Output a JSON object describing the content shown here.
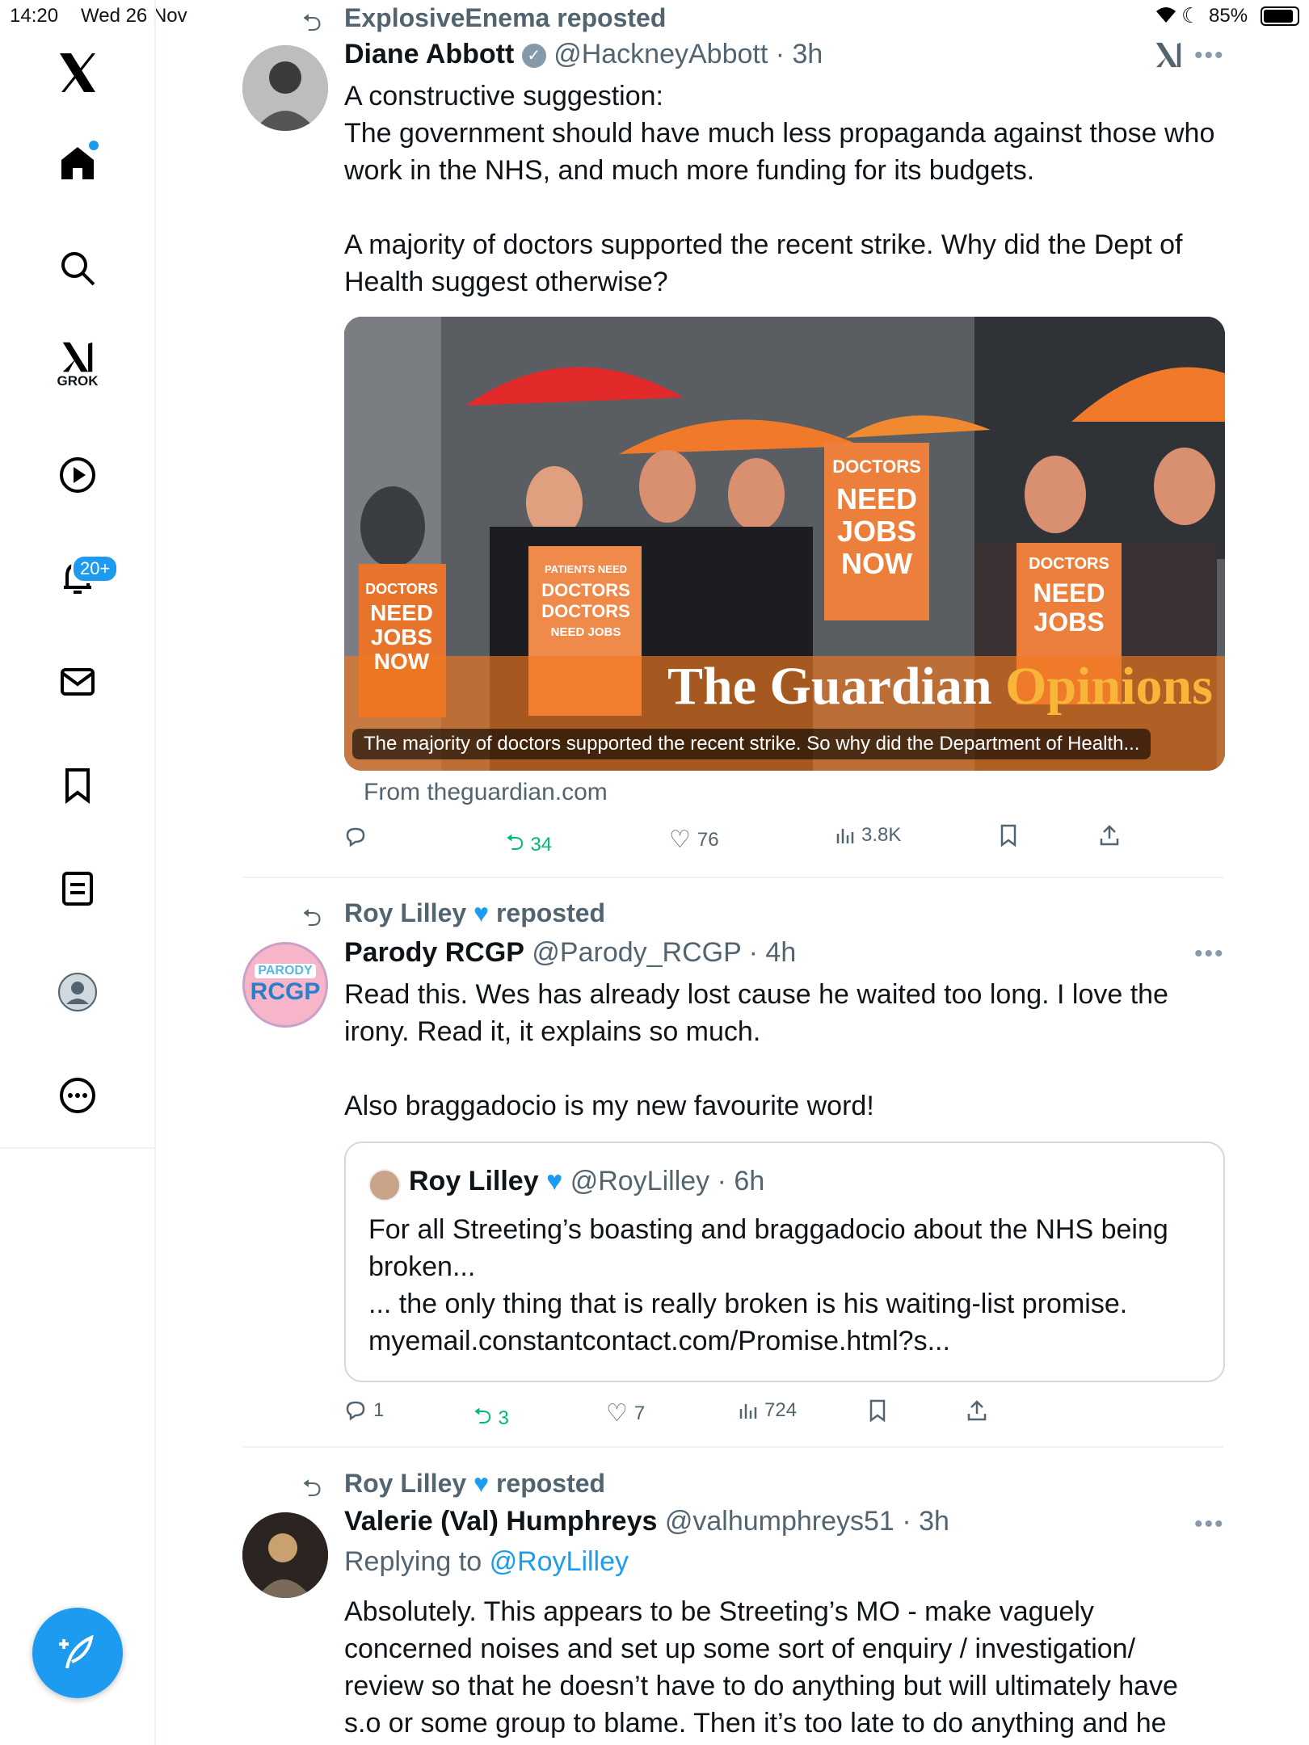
{
  "status": {
    "time": "14:20",
    "date": "Wed 26 Nov",
    "battery": "85%"
  },
  "sidebar": {
    "grok_label": "GROK",
    "notif_badge": "20+"
  },
  "posts": [
    {
      "repost_by": "ExplosiveEnema reposted",
      "name": "Diane Abbott",
      "handle": "@HackneyAbbott",
      "time": "3h",
      "text": "A constructive suggestion:\nThe government should have much less propaganda against those who work in the NHS, and much more funding for its budgets.\n\nA majority of doctors supported the recent strike. Why did the Dept of Health suggest otherwise?",
      "card": {
        "caption": "The majority of doctors supported the recent strike. So why did the Department of Health...",
        "source": "From theguardian.com",
        "brand": "The Guardian",
        "brand2": "Opinions"
      },
      "stats": {
        "replies": "",
        "reposts": "34",
        "likes": "76",
        "views": "3.8K"
      }
    },
    {
      "repost_by_name": "Roy Lilley",
      "repost_label": "reposted",
      "name": "Parody RCGP",
      "handle": "@Parody_RCGP",
      "time": "4h",
      "avatar": {
        "top": "PARODY",
        "main": "RCGP"
      },
      "text": "Read this. Wes has already lost cause he waited too long. I love the irony. Read it, it explains so much.\n\nAlso braggadocio is my new favourite word!",
      "quote": {
        "name": "Roy Lilley",
        "handle": "@RoyLilley",
        "time": "6h",
        "text": "For all Streeting’s boasting and braggadocio about the NHS being broken...\n... the only thing that is really broken is his waiting-list promise.\nmyemail.constantcontact.com/Promise.html?s..."
      },
      "stats": {
        "replies": "1",
        "reposts": "3",
        "likes": "7",
        "views": "724"
      }
    },
    {
      "repost_by_name": "Roy Lilley",
      "repost_label": "reposted",
      "name": "Valerie (Val) Humphreys",
      "handle": "@valhumphreys51",
      "time": "3h",
      "reply_label": "Replying to",
      "reply_to": "@RoyLilley",
      "text": "Absolutely. This  appears to be Streeting’s MO - make vaguely concerned noises and set up some sort of enquiry / investigation/ review so that he doesn’t have to do anything but will ultimately have s.o or some group to blame. Then it’s too late to do anything and he"
    }
  ],
  "image_signs": [
    {
      "line1": "DOCTORS",
      "line2": "NEED",
      "line3": "JOBS",
      "line4": "NOW"
    },
    {
      "line1": "PATIENTS NEED",
      "line2": "DOCTORS",
      "line3": "DOCTORS",
      "line4": "NEED JOBS"
    }
  ],
  "colors": {
    "accent": "#1d9bf0",
    "repost_green": "#00ba7c",
    "heart_blue": "#1d9bf0"
  }
}
